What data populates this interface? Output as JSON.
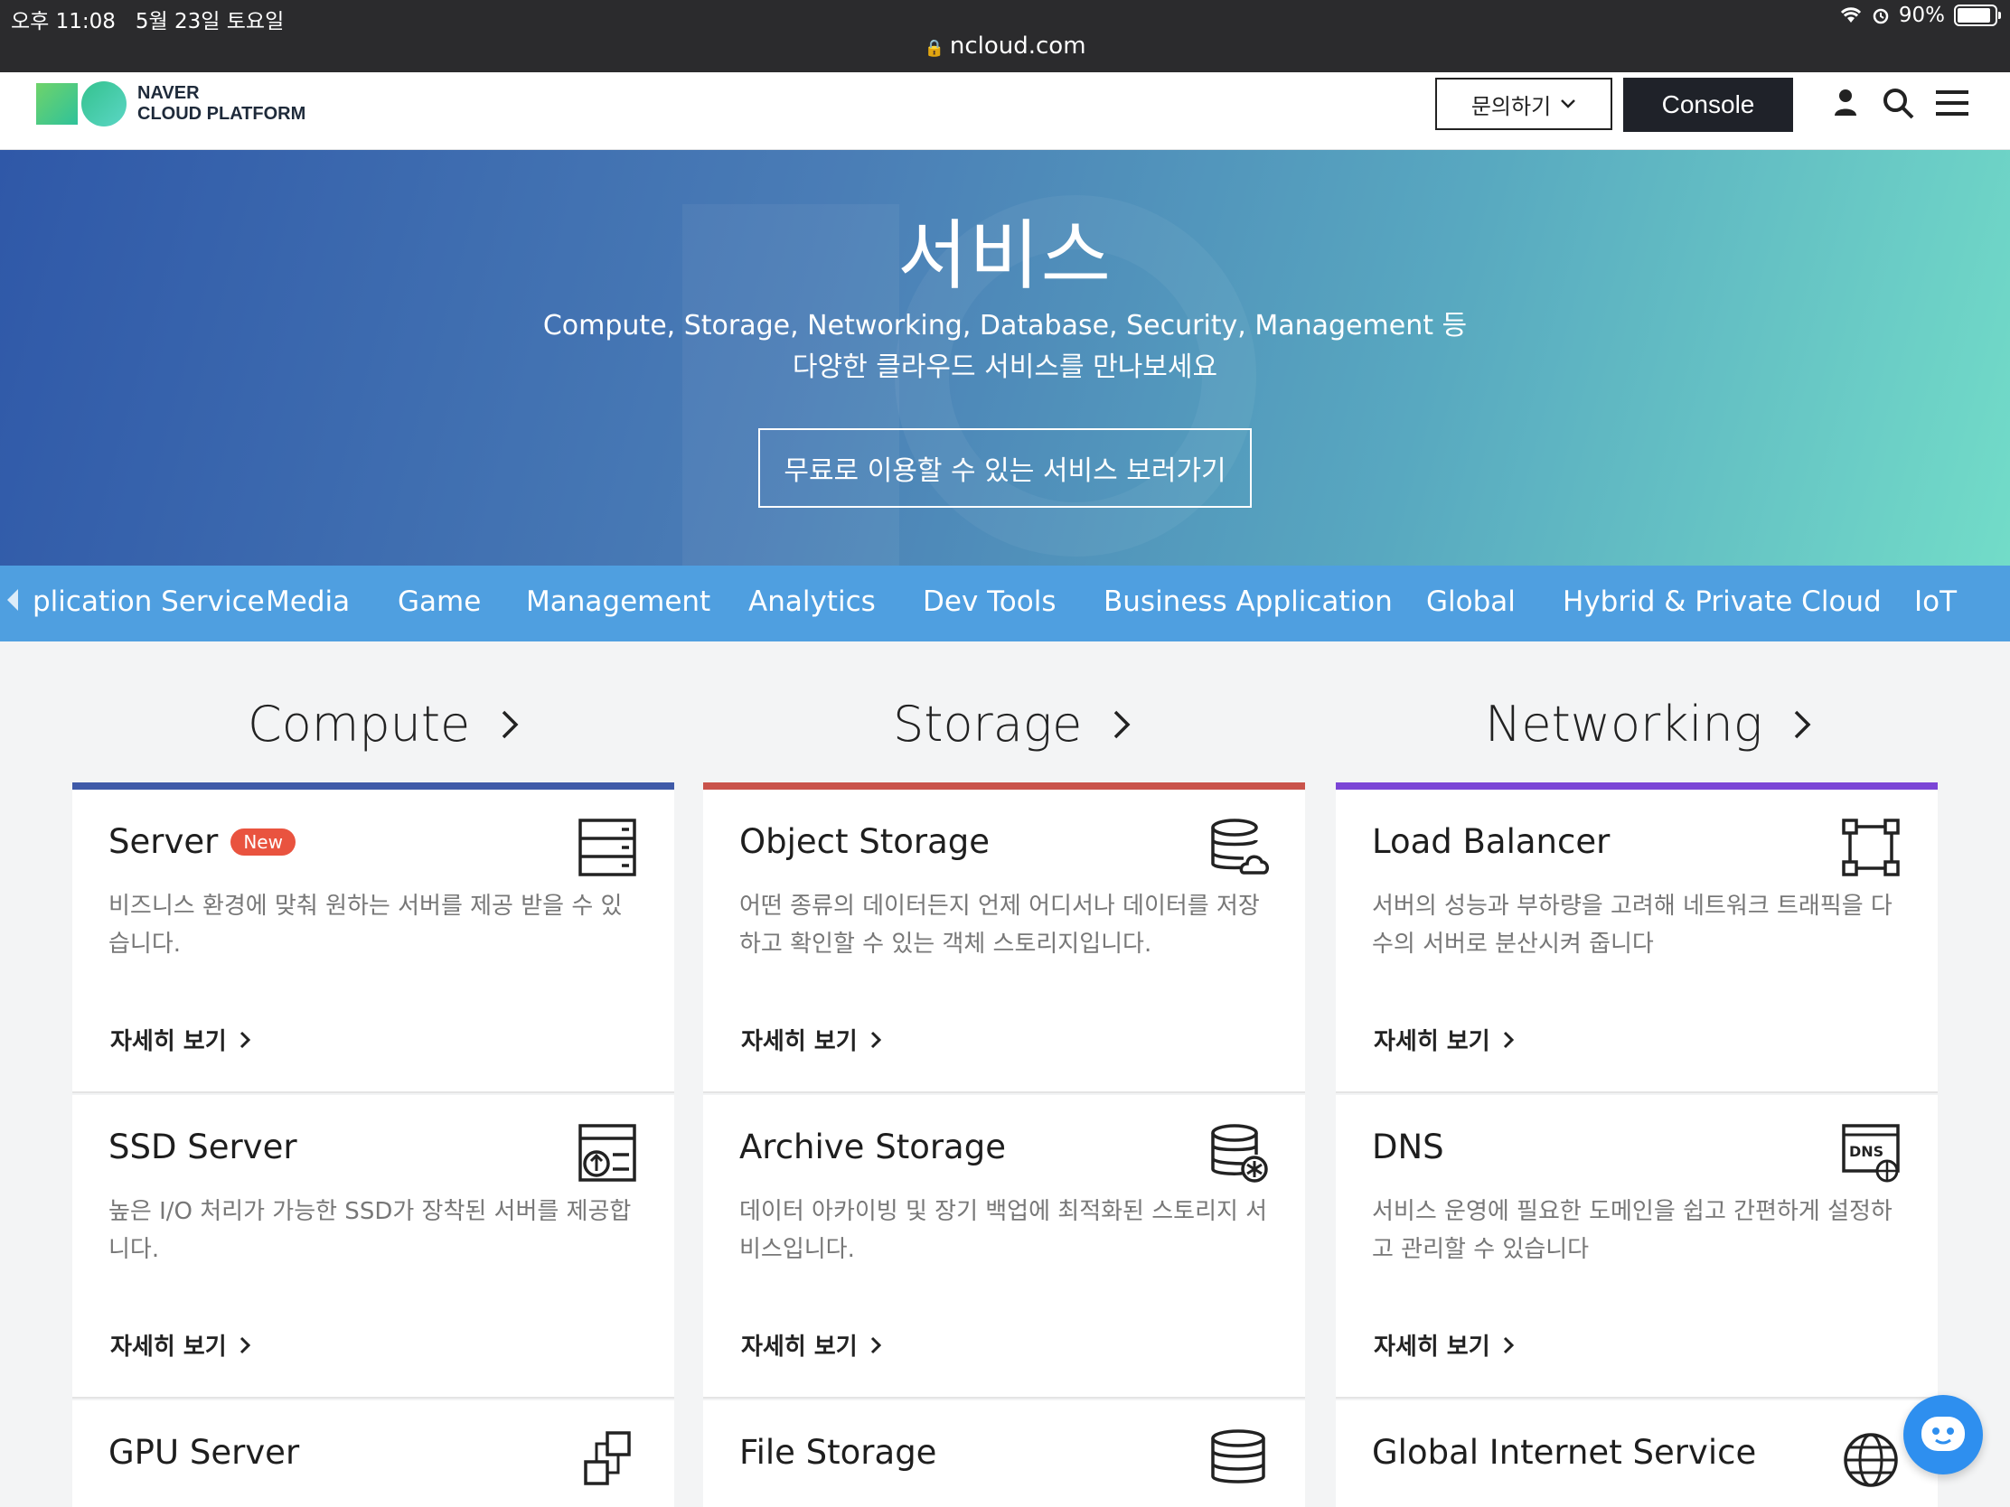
{
  "statusbar": {
    "time": "오후 11:08",
    "date": "5월 23일 토요일",
    "battery": "90%",
    "battery_level": 0.9,
    "url": "ncloud.com"
  },
  "header": {
    "logo_line1": "NAVER",
    "logo_line2": "CLOUD PLATFORM",
    "inquiry_label": "문의하기",
    "console_label": "Console"
  },
  "hero": {
    "title": "서비스",
    "subtitle_line1": "Compute, Storage, Networking, Database, Security, Management 등",
    "subtitle_line2": "다양한 클라우드 서비스를 만나보세요",
    "button_label": "무료로 이용할 수 있는 서비스 보러가기"
  },
  "categories": [
    "plication Service",
    "Media",
    "Game",
    "Management",
    "Analytics",
    "Dev Tools",
    "Business Application",
    "Global",
    "Hybrid & Private Cloud",
    "IoT"
  ],
  "columns": [
    {
      "title": "Compute",
      "color": "#3f5aa8",
      "cards": [
        {
          "title": "Server",
          "badge": "New",
          "desc": "비즈니스 환경에 맞춰 원하는 서버를 제공 받을 수 있습니다.",
          "more": "자세히 보기",
          "icon": "server-rack-icon"
        },
        {
          "title": "SSD Server",
          "desc": "높은 I/O 처리가 가능한 SSD가 장착된 서버를 제공합니다.",
          "more": "자세히 보기",
          "icon": "ssd-server-icon"
        },
        {
          "title": "GPU Server",
          "desc": "",
          "more": "",
          "icon": "gpu-chip-icon"
        }
      ]
    },
    {
      "title": "Storage",
      "color": "#c9534b",
      "cards": [
        {
          "title": "Object Storage",
          "desc": "어떤 종류의 데이터든지 언제 어디서나 데이터를 저장하고 확인할 수 있는 객체 스토리지입니다.",
          "more": "자세히 보기",
          "icon": "database-cloud-icon"
        },
        {
          "title": "Archive Storage",
          "desc": "데이터 아카이빙 및 장기 백업에 최적화된 스토리지 서비스입니다.",
          "more": "자세히 보기",
          "icon": "database-snowflake-icon"
        },
        {
          "title": "File Storage",
          "desc": "",
          "more": "",
          "icon": "database-icon"
        }
      ]
    },
    {
      "title": "Networking",
      "color": "#7b45d6",
      "cards": [
        {
          "title": "Load Balancer",
          "desc": "서버의 성능과 부하량을 고려해 네트워크 트래픽을 다수의 서버로 분산시켜 줍니다",
          "more": "자세히 보기",
          "icon": "load-balancer-icon"
        },
        {
          "title": "DNS",
          "desc": "서비스 운영에 필요한 도메인을 쉽고 간편하게 설정하고 관리할 수 있습니다",
          "more": "자세히 보기",
          "icon": "dns-globe-icon"
        },
        {
          "title": "Global Internet Service",
          "desc": "",
          "more": "",
          "icon": "globe-icon"
        }
      ]
    }
  ]
}
